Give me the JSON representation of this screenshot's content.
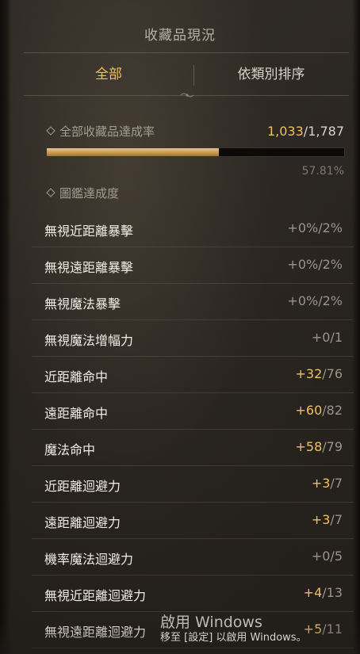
{
  "header": {
    "title": "收藏品現況"
  },
  "tabs": [
    {
      "label": "全部",
      "active": true
    },
    {
      "label": "依類別排序",
      "active": false
    }
  ],
  "summary": {
    "label": "全部收藏品達成率",
    "current": "1,033",
    "total": "/1,787",
    "percent_text": "57.81%",
    "progress_fraction": 0.5781
  },
  "section": {
    "label": "圖鑑達成度"
  },
  "stats": [
    {
      "label": "無視近距離暴擊",
      "gain": "+0%",
      "max": "/2%"
    },
    {
      "label": "無視遠距離暴擊",
      "gain": "+0%",
      "max": "/2%"
    },
    {
      "label": "無視魔法暴擊",
      "gain": "+0%",
      "max": "/2%"
    },
    {
      "label": "無視魔法增幅力",
      "gain": "+0",
      "max": "/1"
    },
    {
      "label": "近距離命中",
      "gain": "+32",
      "max": "/76"
    },
    {
      "label": "遠距離命中",
      "gain": "+60",
      "max": "/82"
    },
    {
      "label": "魔法命中",
      "gain": "+58",
      "max": "/79"
    },
    {
      "label": "近距離迴避力",
      "gain": "+3",
      "max": "/7"
    },
    {
      "label": "遠距離迴避力",
      "gain": "+3",
      "max": "/7"
    },
    {
      "label": "機率魔法迴避力",
      "gain": "+0",
      "max": "/5"
    },
    {
      "label": "無視近距離迴避力",
      "gain": "+4",
      "max": "/13"
    },
    {
      "label": "無視遠距離迴避力",
      "gain": "+5",
      "max": "/11"
    }
  ],
  "watermark": {
    "line1": "啟用 Windows",
    "line2": "移至 [設定] 以啟用 Windows。"
  },
  "colors": {
    "accent": "#f0c060",
    "text": "#f2ede5",
    "muted": "#9a9388",
    "background": "#27231f"
  }
}
